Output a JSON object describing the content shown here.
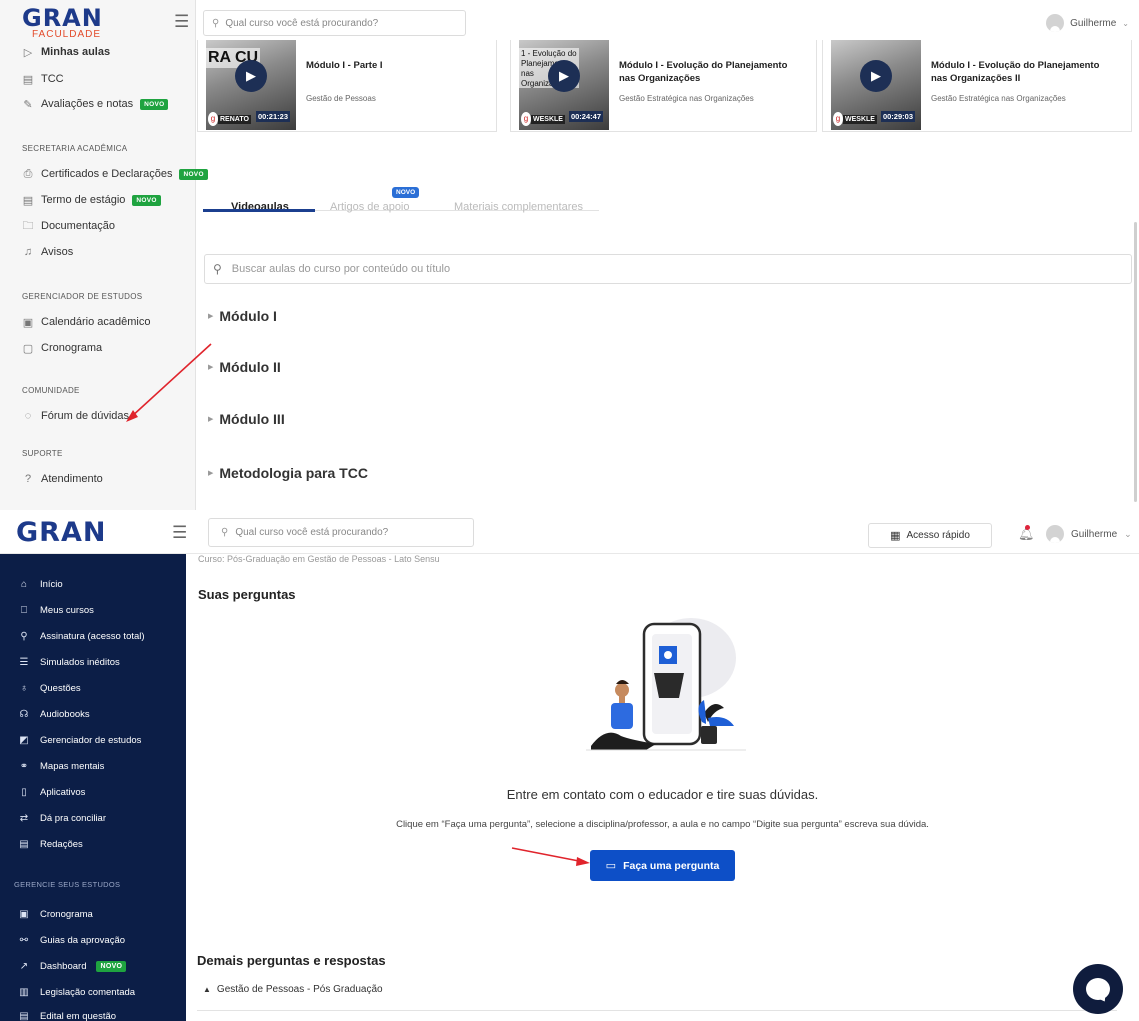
{
  "top": {
    "logo": {
      "brand": "GRAN",
      "sub": "FACULDADE"
    },
    "search_placeholder": "Qual curso você está procurando?",
    "user_name": "Guilherme",
    "sidebar": {
      "items_a": [
        {
          "label": "Minhas aulas",
          "icon": "play-outline-icon"
        },
        {
          "label": "TCC",
          "icon": "document-icon"
        },
        {
          "label": "Avaliações e notas",
          "icon": "pencil-icon",
          "badge": "NOVO"
        }
      ],
      "section_secretaria": "SECRETARIA ACADÊMICA",
      "items_b": [
        {
          "label": "Certificados e Declarações",
          "icon": "certificate-icon",
          "badge": "NOVO"
        },
        {
          "label": "Termo de estágio",
          "icon": "document-icon",
          "badge": "NOVO"
        },
        {
          "label": "Documentação",
          "icon": "folder-icon"
        },
        {
          "label": "Avisos",
          "icon": "bell-icon"
        }
      ],
      "section_gerenciador": "GERENCIADOR DE ESTUDOS",
      "items_c": [
        {
          "label": "Calendário acadêmico",
          "icon": "calendar-check-icon"
        },
        {
          "label": "Cronograma",
          "icon": "calendar-icon"
        }
      ],
      "section_comunidade": "COMUNIDADE",
      "forum": "Fórum de dúvidas",
      "section_suporte": "SUPORTE",
      "atendimento": "Atendimento"
    },
    "videos": [
      {
        "thumb_text": "RA  CU",
        "title": "Módulo I - Parte I",
        "subtitle": "Gestão de Pessoas",
        "duration": "00:21:23",
        "presenter": "RENATO"
      },
      {
        "thumb_text": "1 - Evolução do Planejamento nas Organizações",
        "title": "Módulo I - Evolução do Planejamento nas Organizações",
        "subtitle": "Gestão Estratégica nas Organizações",
        "duration": "00:24:47",
        "presenter": "WESKLE"
      },
      {
        "thumb_text": "",
        "title": "Módulo I - Evolução do Planejamento nas Organizações II",
        "subtitle": "Gestão Estratégica nas Organizações",
        "duration": "00:29:03",
        "presenter": "WESKLE"
      }
    ],
    "tabs": [
      {
        "label": "Videoaulas",
        "active": true
      },
      {
        "label": "Artigos de apoio",
        "active": false,
        "badge": "NOVO"
      },
      {
        "label": "Materiais complementares",
        "active": false
      }
    ],
    "course_search_placeholder": "Buscar aulas do curso por conteúdo ou título",
    "modules": [
      "Módulo I",
      "Módulo II",
      "Módulo III",
      "Metodologia para TCC"
    ]
  },
  "bottom": {
    "logo": "GRAN",
    "search_placeholder": "Qual curso você está procurando?",
    "quick_access": "Acesso rápido",
    "user_name": "Guilherme",
    "breadcrumb": "Curso: Pós-Graduação em Gestão de Pessoas - Lato Sensu",
    "sidebar": {
      "items": [
        {
          "label": "Início",
          "icon": "home-icon"
        },
        {
          "label": "Meus cursos",
          "icon": "bookmark-icon"
        },
        {
          "label": "Assinatura (acesso total)",
          "icon": "search-icon"
        },
        {
          "label": "Simulados inéditos",
          "icon": "list-icon"
        },
        {
          "label": "Questões",
          "icon": "lightbulb-icon"
        },
        {
          "label": "Audiobooks",
          "icon": "headphones-icon"
        },
        {
          "label": "Gerenciador de estudos",
          "icon": "edit-square-icon"
        },
        {
          "label": "Mapas mentais",
          "icon": "mind-map-icon"
        },
        {
          "label": "Aplicativos",
          "icon": "phone-icon"
        },
        {
          "label": "Dá pra conciliar",
          "icon": "swap-icon"
        },
        {
          "label": "Redações",
          "icon": "document-icon"
        }
      ],
      "section": "GERENCIE SEUS ESTUDOS",
      "items2": [
        {
          "label": "Cronograma",
          "icon": "calendar-check-icon"
        },
        {
          "label": "Guias da aprovação",
          "icon": "route-icon"
        },
        {
          "label": "Dashboard",
          "icon": "chart-line-icon",
          "badge": "NOVO"
        },
        {
          "label": "Legislação comentada",
          "icon": "clipboard-icon"
        },
        {
          "label": "Edital em questão",
          "icon": "document-icon"
        }
      ]
    },
    "title": "Suas perguntas",
    "contact_text": "Entre em contato com o educador e tire suas dúvidas.",
    "instruction_text": "Clique em “Faça uma pergunta”, selecione a disciplina/professor, a aula e no campo “Digite sua pergunta” escreva sua dúvida.",
    "ask_button": "Faça uma pergunta",
    "other_title": "Demais perguntas e respostas",
    "accordion_label": "Gestão de Pessoas - Pós Graduação"
  },
  "colors": {
    "brand_navy": "#1d3a8a",
    "sidebar_dark": "#0c1e47",
    "primary_button": "#0d4fc7",
    "badge_green": "#1fa340",
    "annotation_arrow": "#e0242c"
  }
}
